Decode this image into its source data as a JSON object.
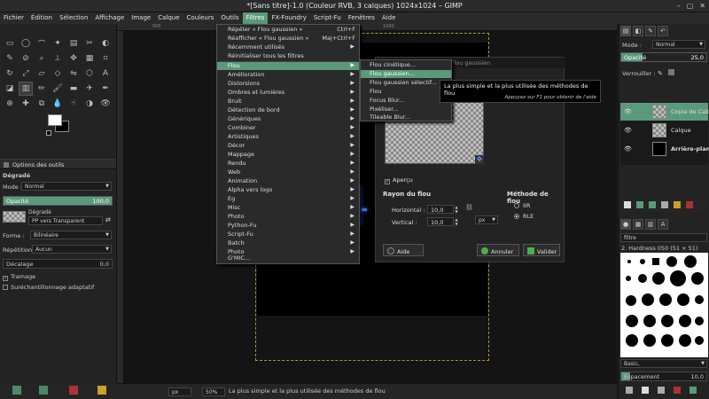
{
  "window": {
    "title": "*[Sans titre]-1.0 (Couleur RVB, 3 calques) 1024x1024 – GIMP"
  },
  "menubar": [
    "Fichier",
    "Édition",
    "Sélection",
    "Affichage",
    "Image",
    "Calque",
    "Couleurs",
    "Outils",
    "Filtres",
    "FX-Foundry",
    "Script-Fu",
    "Fenêtres",
    "Aide"
  ],
  "filters_menu": {
    "repeat": {
      "label": "Répéter « Flou gaussien »",
      "shortcut": "Ctrl+F"
    },
    "reshow": {
      "label": "Réafficher « Flou gaussien »",
      "shortcut": "Maj+Ctrl+F"
    },
    "recent": "Récemment utilisés",
    "reset": "Réinitialiser tous les filtres",
    "items": [
      "Flou",
      "Amélioration",
      "Distorsions",
      "Ombres et lumières",
      "Bruit",
      "Détection de bord",
      "Génériques",
      "Combiner",
      "Artistiques",
      "Décor",
      "Mappage",
      "Rendu",
      "Web",
      "Animation",
      "Alpha vers logo",
      "Eg",
      "Misc",
      "Photo",
      "Python-Fu",
      "Script-Fu",
      "Batch",
      "Photo",
      "G'MIC..."
    ]
  },
  "blur_submenu": [
    "Flou cinétique...",
    "Flou gaussien...",
    "Flou gaussien sélectif...",
    "Flou",
    "Focus Blur...",
    "Pixéliser...",
    "Tileable Blur..."
  ],
  "tooltip": {
    "text": "La plus simple et la plus utilisée des méthodes de flou",
    "hint": "Appuyez sur F1 pour obtenir de l'aide"
  },
  "dialog": {
    "title": "Flou gaussien",
    "preview_label": "Aperçu",
    "radius_header": "Rayon du flou",
    "horizontal_label": "Horizontal :",
    "horizontal_value": "10,0",
    "vertical_label": "Vertical :",
    "vertical_value": "10,0",
    "unit": "px",
    "method_header": "Méthode de flou",
    "method_options": [
      "IIR",
      "RLE"
    ],
    "help": "Aide",
    "cancel": "Annuler",
    "ok": "Valider"
  },
  "tool_options": {
    "tab": "Options des outils",
    "tool_name": "Dégradé",
    "mode_label": "Mode :",
    "mode_value": "Normal",
    "opacity_label": "Opacité",
    "opacity_value": "100,0",
    "gradient_label": "Dégradé",
    "gradient_value": "PP vers Transparent",
    "shape_label": "Forme :",
    "shape_value": "Bilinéaire",
    "repeat_label": "Répétition :",
    "repeat_value": "Aucun",
    "offset_label": "Décalage",
    "offset_value": "0,0",
    "dither_label": "Tramage",
    "adaptive_label": "Suréchantillonnage adaptatif"
  },
  "statusbar": {
    "unit": "px",
    "zoom": "50%",
    "message": "La plus simple et la plus utilisée des méthodes de flou"
  },
  "ruler_ticks": [
    "500",
    "750",
    "1000"
  ],
  "layers_panel": {
    "mode_label": "Mode :",
    "mode_value": "Normal",
    "opacity_label": "Opacité",
    "opacity_value": "25,0",
    "lock_label": "Verrouiller :",
    "layers": [
      "Copie de Calq",
      "Calque",
      "Arrière-plan"
    ]
  },
  "brushes_panel": {
    "filter": "filtre",
    "brush_name": "2. Hardness 050 (51 × 51)",
    "preset": "Basic,",
    "spacing_label": "Espacement",
    "spacing_value": "10,0"
  },
  "colors": {
    "accent": "#5a9a7a",
    "glow": "#3c6ef8",
    "selection": "#a49a3a"
  }
}
